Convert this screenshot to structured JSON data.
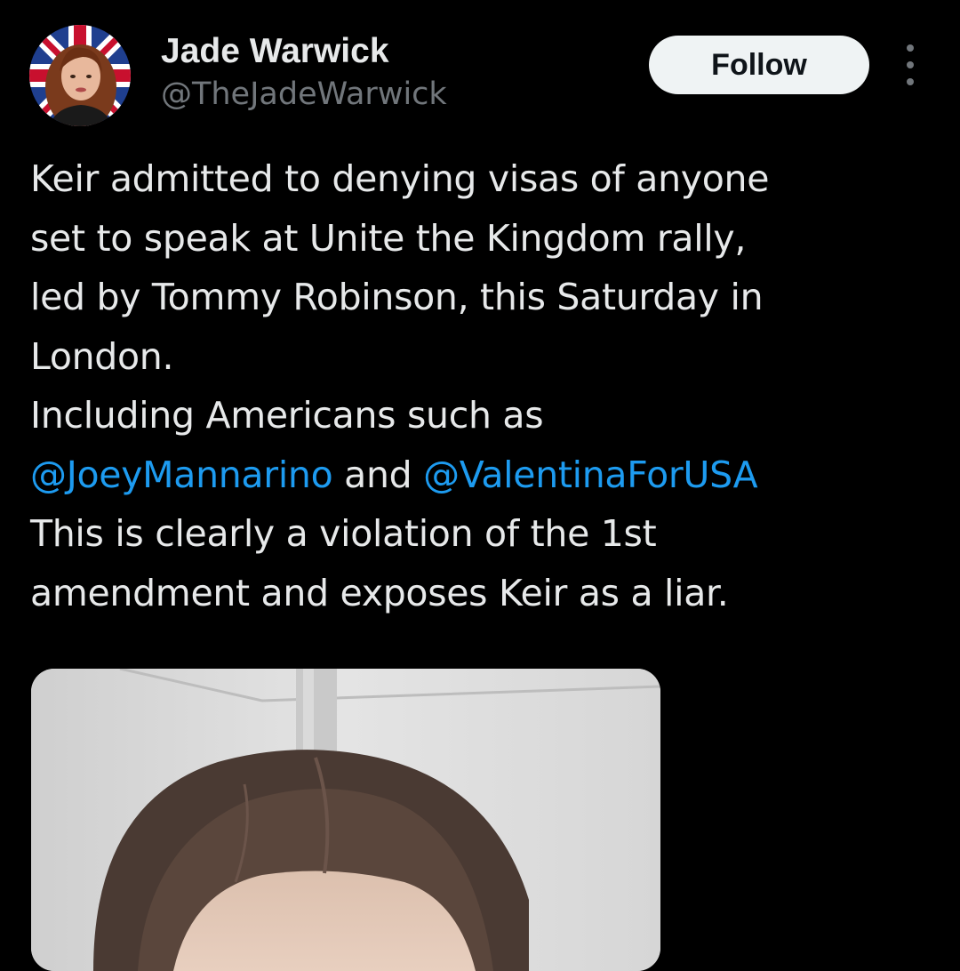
{
  "author": {
    "display_name": "Jade Warwick",
    "handle": "@TheJadeWarwick",
    "avatar_icon": "profile-photo-union-jack"
  },
  "actions": {
    "follow_label": "Follow",
    "more_icon": "more-vertical-icon"
  },
  "tweet": {
    "lines": [
      "Keir admitted to denying visas of anyone",
      "set to speak at Unite the Kingdom rally,",
      "led by Tommy Robinson, this Saturday in",
      "London.",
      "Including Americans such as"
    ],
    "mention_1": "@JoeyMannarino",
    "connector": " and ",
    "mention_2": "@ValentinaForUSA",
    "lines_after": [
      "This is clearly a violation of the 1st",
      "amendment and exposes Keir as a liar."
    ]
  },
  "media": {
    "icon": "video-thumbnail"
  },
  "colors": {
    "background": "#000000",
    "text": "#e7e9ea",
    "secondary": "#71767b",
    "link": "#1d9bf0",
    "follow_bg": "#eff3f4"
  }
}
